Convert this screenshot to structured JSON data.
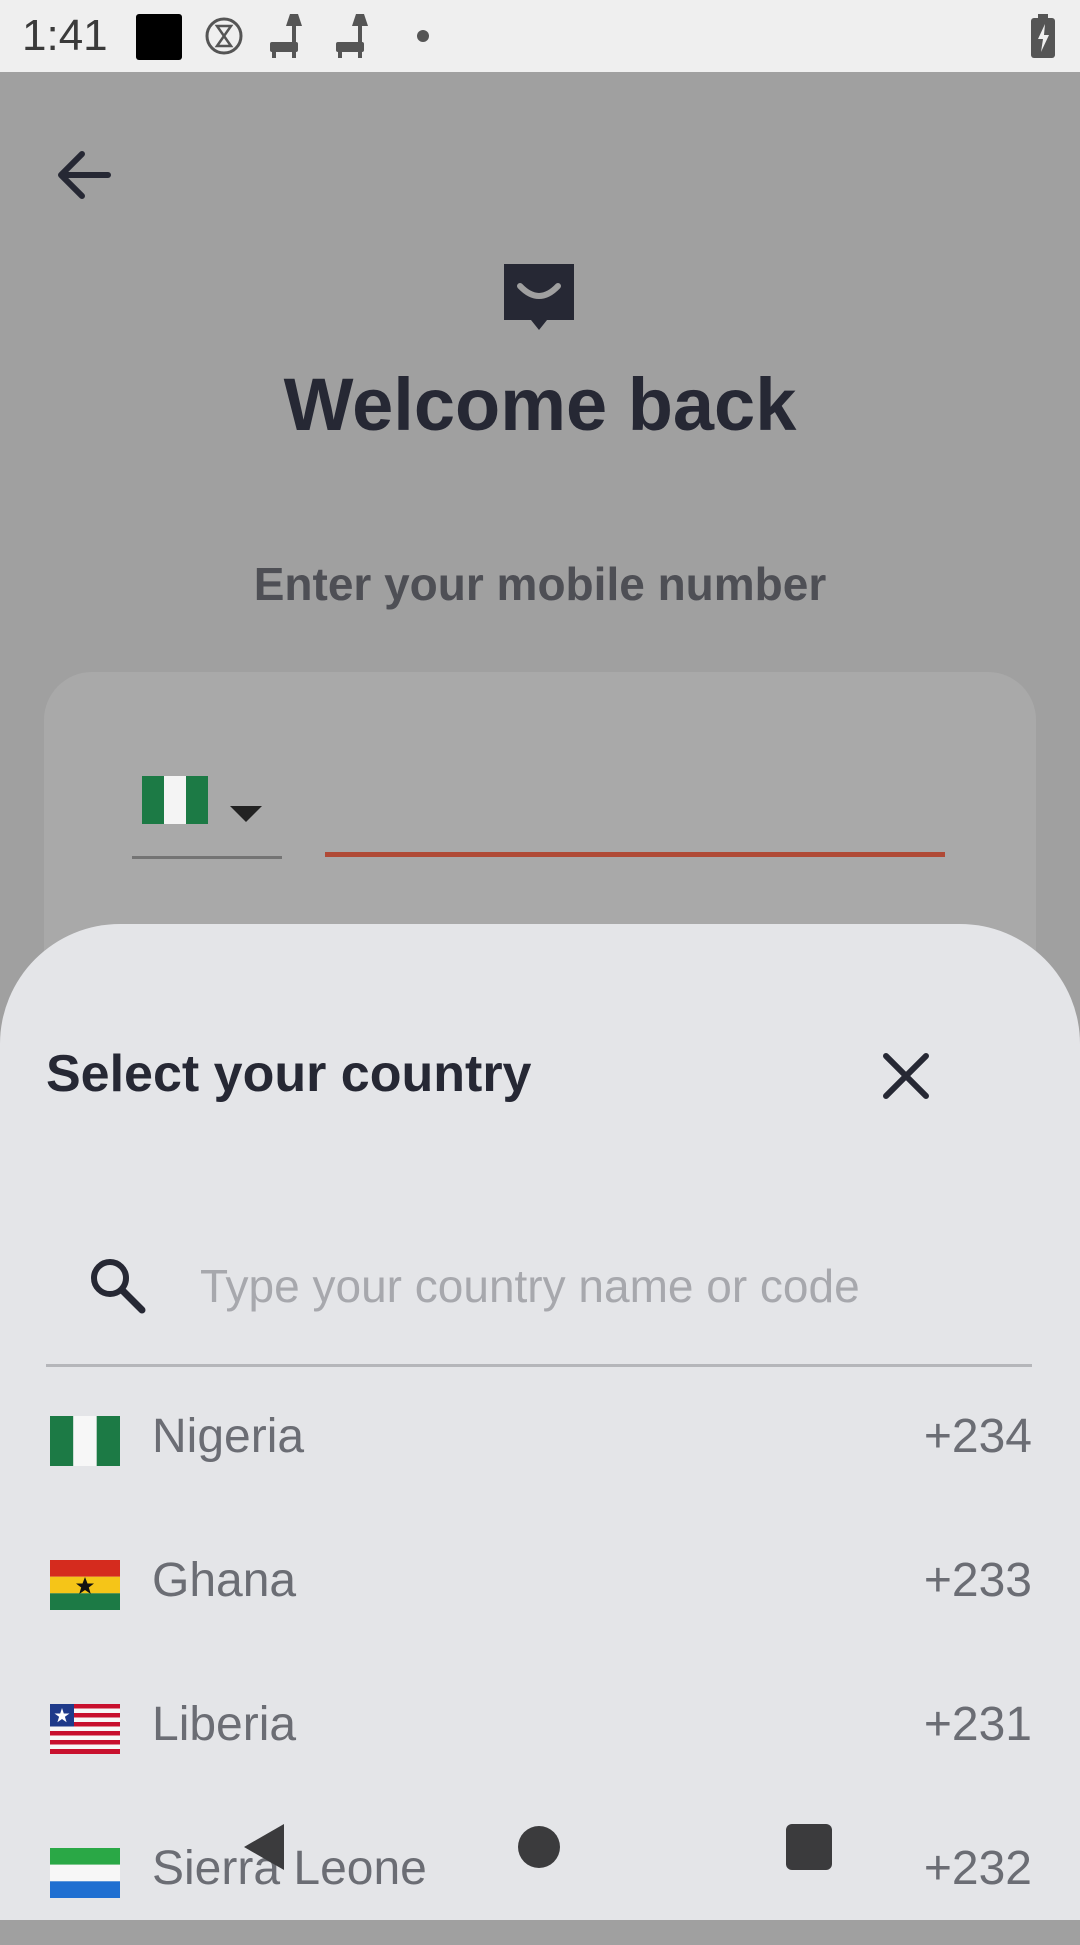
{
  "status_bar": {
    "time": "1:41",
    "icons": [
      "square-icon",
      "hourglass-icon",
      "lamp-icon",
      "lamp-icon",
      "dot-icon",
      "battery-charging-icon"
    ]
  },
  "page": {
    "title": "Welcome back",
    "subtitle": "Enter your mobile number",
    "selected_country_flag": "nigeria-flag-icon",
    "accent_color": "#b04a36"
  },
  "sheet": {
    "title": "Select your country",
    "search_placeholder": "Type your country name or code",
    "countries": [
      {
        "name": "Nigeria",
        "code": "+234",
        "flag": "nigeria-flag-icon"
      },
      {
        "name": "Ghana",
        "code": "+233",
        "flag": "ghana-flag-icon"
      },
      {
        "name": "Liberia",
        "code": "+231",
        "flag": "liberia-flag-icon"
      },
      {
        "name": "Sierra Leone",
        "code": "+232",
        "flag": "sierra-leone-flag-icon"
      }
    ]
  },
  "nav_bar": {
    "icons": [
      "back-triangle-icon",
      "home-circle-icon",
      "recents-square-icon"
    ]
  }
}
